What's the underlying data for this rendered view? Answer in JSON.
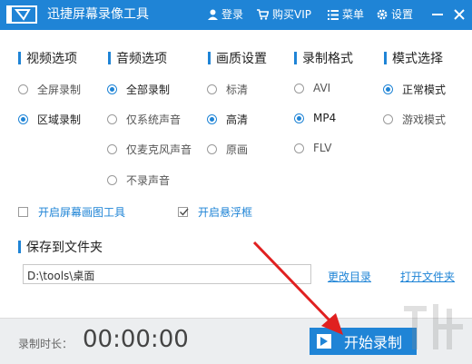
{
  "titlebar": {
    "app_title": "迅捷屏幕录像工具",
    "login": "登录",
    "buy_vip": "购买VIP",
    "menu": "菜单",
    "settings": "设置",
    "bg_color": "#1f84d6"
  },
  "columns": [
    {
      "heading": "视频选项",
      "options": [
        "全屏录制",
        "区域录制"
      ],
      "selected": 1
    },
    {
      "heading": "音频选项",
      "options": [
        "全部录制",
        "仅系统声音",
        "仅麦克风声音",
        "不录声音"
      ],
      "selected": 0
    },
    {
      "heading": "画质设置",
      "options": [
        "标清",
        "高清",
        "原画"
      ],
      "selected": 1
    },
    {
      "heading": "录制格式",
      "options": [
        "AVI",
        "MP4",
        "FLV"
      ],
      "selected": 1
    },
    {
      "heading": "模式选择",
      "options": [
        "正常模式",
        "游戏模式"
      ],
      "selected": 0
    }
  ],
  "checkboxes": [
    {
      "label": "开启屏幕画图工具",
      "checked": false
    },
    {
      "label": "开启悬浮框",
      "checked": true
    }
  ],
  "save": {
    "heading": "保存到文件夹",
    "path": "D:\\tools\\桌面",
    "change_dir": "更改目录",
    "open_folder": "打开文件夹"
  },
  "footer": {
    "duration_label": "录制时长：",
    "duration_value": "00:00:00",
    "start_button": "开始录制"
  },
  "colors": {
    "accent": "#1f84d6",
    "annotation_arrow": "#e02020"
  }
}
